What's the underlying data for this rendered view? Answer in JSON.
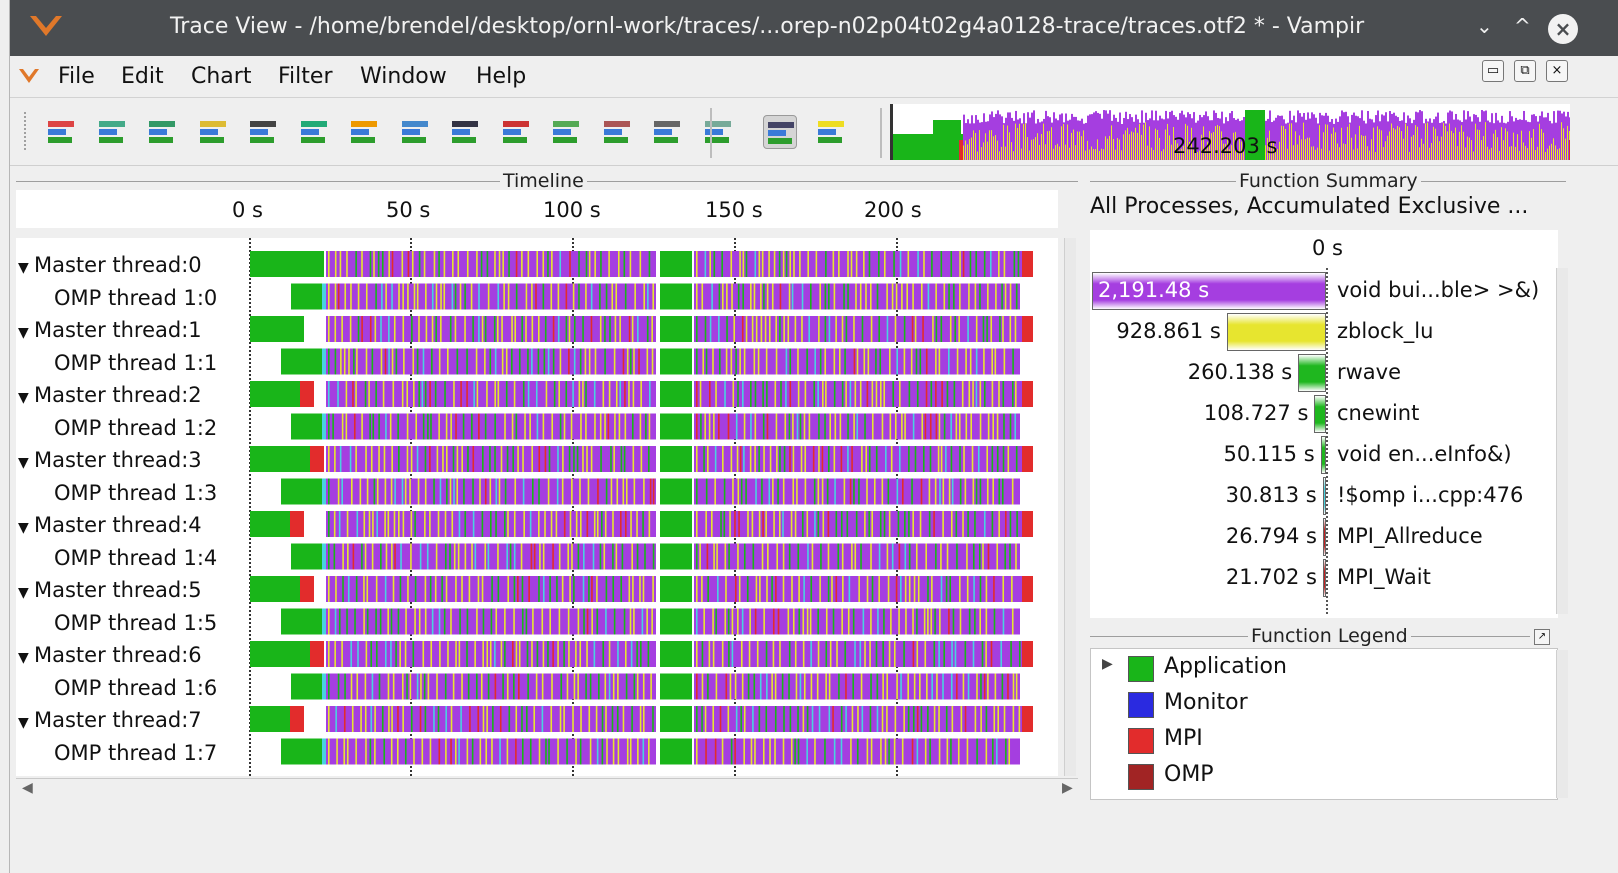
{
  "window": {
    "title": "Trace View - /home/brendel/desktop/ornl-work/traces/...orep-n02p04t02g4a0128-trace/traces.otf2 * - Vampir",
    "controls": [
      "⌄",
      "^",
      "×"
    ]
  },
  "menu": {
    "items": [
      {
        "name": "file",
        "label": "File"
      },
      {
        "name": "edit",
        "label": "Edit"
      },
      {
        "name": "chart",
        "label": "Chart"
      },
      {
        "name": "filter",
        "label": "Filter"
      },
      {
        "name": "window",
        "label": "Window"
      },
      {
        "name": "help",
        "label": "Help"
      }
    ]
  },
  "toolbar": {
    "tools": [
      "master-timeline-icon",
      "process-timeline-icon",
      "counter-timeline-icon",
      "performance-radar-icon",
      "io-timeline-icon",
      "summary-timeline-icon",
      "function-summary-pie-icon",
      "message-summary-icon",
      "process-summary-icon",
      "communication-matrix-icon",
      "io-summary-icon",
      "call-tree-icon",
      "context-view-icon",
      "marker-view-icon",
      "pin-icon",
      "lightbulb-icon"
    ],
    "overview_label": "242.203 s"
  },
  "timeline": {
    "title": "Timeline",
    "ticks": [
      "0 s",
      "50 s",
      "100 s",
      "150 s",
      "200 s"
    ],
    "processes": [
      {
        "label": "Master thread:0",
        "expanded": true
      },
      {
        "label": "OMP thread 1:0",
        "expanded": false
      },
      {
        "label": "Master thread:1",
        "expanded": true
      },
      {
        "label": "OMP thread 1:1",
        "expanded": false
      },
      {
        "label": "Master thread:2",
        "expanded": true
      },
      {
        "label": "OMP thread 1:2",
        "expanded": false
      },
      {
        "label": "Master thread:3",
        "expanded": true
      },
      {
        "label": "OMP thread 1:3",
        "expanded": false
      },
      {
        "label": "Master thread:4",
        "expanded": true
      },
      {
        "label": "OMP thread 1:4",
        "expanded": false
      },
      {
        "label": "Master thread:5",
        "expanded": true
      },
      {
        "label": "OMP thread 1:5",
        "expanded": false
      },
      {
        "label": "Master thread:6",
        "expanded": true
      },
      {
        "label": "OMP thread 1:6",
        "expanded": false
      },
      {
        "label": "Master thread:7",
        "expanded": true
      },
      {
        "label": "OMP thread 1:7",
        "expanded": false
      }
    ]
  },
  "function_summary": {
    "title": "Function Summary",
    "header": "All Processes, Accumulated Exclusive ...",
    "zero_label": "0 s",
    "rows": [
      {
        "value_label": "2,191.48 s",
        "value": 2191.48,
        "name": "void bui...ble> >&)",
        "color": "#a53ee0"
      },
      {
        "value_label": "928.861 s",
        "value": 928.861,
        "name": "zblock_lu",
        "color": "#e7e52f"
      },
      {
        "value_label": "260.138 s",
        "value": 260.138,
        "name": "rwave",
        "color": "#1fb71f"
      },
      {
        "value_label": "108.727 s",
        "value": 108.727,
        "name": "cnewint",
        "color": "#1fb71f"
      },
      {
        "value_label": "50.115 s",
        "value": 50.115,
        "name": "void en...eInfo&)",
        "color": "#1fb71f"
      },
      {
        "value_label": "30.813 s",
        "value": 30.813,
        "name": "!$omp i...cpp:476",
        "color": "#49d2e0"
      },
      {
        "value_label": "26.794 s",
        "value": 26.794,
        "name": "MPI_Allreduce",
        "color": "#c72020"
      },
      {
        "value_label": "21.702 s",
        "value": 21.702,
        "name": "MPI_Wait",
        "color": "#c72020"
      }
    ]
  },
  "function_legend": {
    "title": "Function Legend",
    "items": [
      {
        "label": "Application",
        "color": "#19b519"
      },
      {
        "label": "Monitor",
        "color": "#2a2ae0"
      },
      {
        "label": "MPI",
        "color": "#e22c2c"
      },
      {
        "label": "OMP",
        "color": "#a12424"
      }
    ]
  },
  "colors": {
    "application": "#19b519",
    "compute": "#a53ee0",
    "zblock": "#e7e52f",
    "mpi": "#e22c2c",
    "omp": "#49d2e0"
  }
}
